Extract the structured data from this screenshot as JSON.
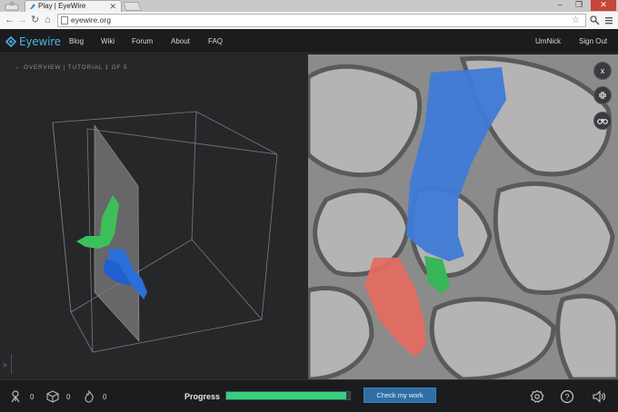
{
  "browser": {
    "tab_title": "Play | EyeWire",
    "tab_close": "✕",
    "url": "eyewire.org",
    "nav": {
      "back": "←",
      "forward": "→",
      "reload": "↻",
      "home": "⌂"
    },
    "star": "☆",
    "window": {
      "minimize": "–",
      "maximize": "❐",
      "close": "✕"
    }
  },
  "site": {
    "logo": "Eyewire",
    "nav_links": [
      "Blog",
      "Wiki",
      "Forum",
      "About",
      "FAQ"
    ],
    "username": "UmNick",
    "sign_out": "Sign Out",
    "accent": "#4fb0e4"
  },
  "tutorial": {
    "breadcrumb": "← OVERVIEW | TUTORIAL 1 OF 5",
    "console_prompt": ">"
  },
  "side_buttons": {
    "close": "x"
  },
  "bottom": {
    "stats": [
      {
        "icon": "cubes-icon",
        "value": "0"
      },
      {
        "icon": "cube-icon",
        "value": "0"
      },
      {
        "icon": "flame-icon",
        "value": "0"
      }
    ],
    "progress_label": "Progress",
    "progress_fraction": 0.97,
    "progress_color": "#35d07f",
    "check_button": "Check my work"
  }
}
